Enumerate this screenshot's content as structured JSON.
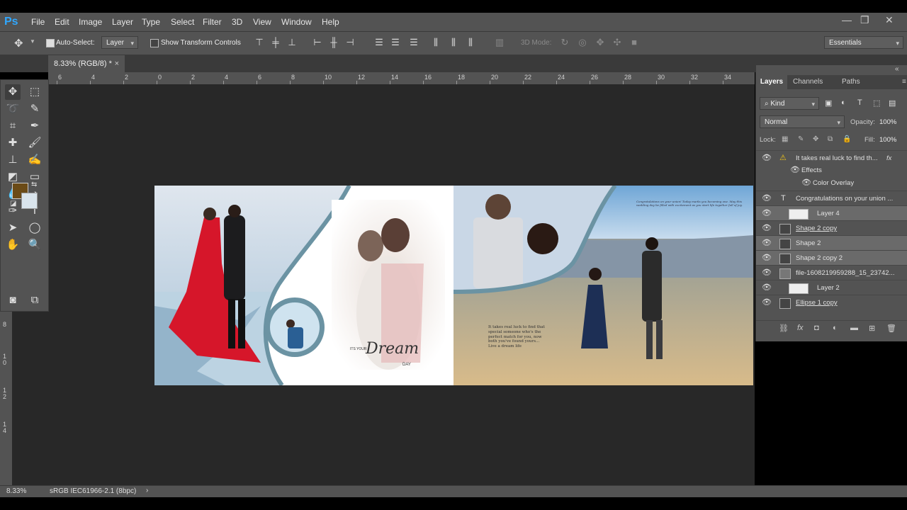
{
  "app": {
    "logo": "Ps"
  },
  "menu": [
    "File",
    "Edit",
    "Image",
    "Layer",
    "Type",
    "Select",
    "Filter",
    "3D",
    "View",
    "Window",
    "Help"
  ],
  "window_controls": {
    "minimize": "—",
    "restore": "❐",
    "close": "✕"
  },
  "options": {
    "auto_select_label": "Auto-Select:",
    "auto_select_value": "Layer",
    "show_transform_label": "Show Transform Controls",
    "mode_3d_label": "3D Mode:",
    "workspace": "Essentials"
  },
  "document": {
    "tab_title": "8.33% (RGB/8) *",
    "close": "×"
  },
  "ruler": {
    "top": [
      "6",
      "4",
      "2",
      "0",
      "2",
      "4",
      "6",
      "8",
      "10",
      "12",
      "14",
      "16",
      "18",
      "20",
      "22",
      "24",
      "26",
      "28",
      "30",
      "32",
      "34"
    ],
    "left": [
      "8",
      "1\n0",
      "1\n2",
      "1\n4"
    ]
  },
  "artboard": {
    "dream_prefix": "ITS YOUR",
    "dream_word": "Dream",
    "dream_suffix": "DAY",
    "quote": "It takes real luck to find that special someone who's the perfect match for you, now both you've found yours... Live a dream life",
    "congrats_small": "Congratulations on your union! Today marks you becoming one. May this wedding day be filled with excitement as you start life together full of joy."
  },
  "layers_panel": {
    "tabs": [
      "Layers",
      "Channels",
      "Paths"
    ],
    "kind_label": "Kind",
    "blend_mode": "Normal",
    "opacity_label": "Opacity:",
    "opacity_value": "100%",
    "lock_label": "Lock:",
    "fill_label": "Fill:",
    "fill_value": "100%",
    "layers": [
      {
        "name": "It takes real luck to find th...",
        "type": "text-warn"
      },
      {
        "name": "Effects",
        "type": "effects"
      },
      {
        "name": "Color Overlay",
        "type": "effect"
      },
      {
        "name": "Congratulations on your union ...",
        "type": "text"
      },
      {
        "name": "Layer 4",
        "type": "pixel"
      },
      {
        "name": "Shape 2 copy",
        "type": "shape"
      },
      {
        "name": "Shape 2",
        "type": "shape"
      },
      {
        "name": "Shape 2 copy 2",
        "type": "shape"
      },
      {
        "name": "file-1608219959288_15_23742...",
        "type": "smart"
      },
      {
        "name": "Layer 2",
        "type": "pixel"
      },
      {
        "name": "Ellipse 1 copy",
        "type": "shape"
      }
    ]
  },
  "status": {
    "zoom": "8.33%",
    "profile": "sRGB IEC61966-2.1 (8bpc)"
  }
}
